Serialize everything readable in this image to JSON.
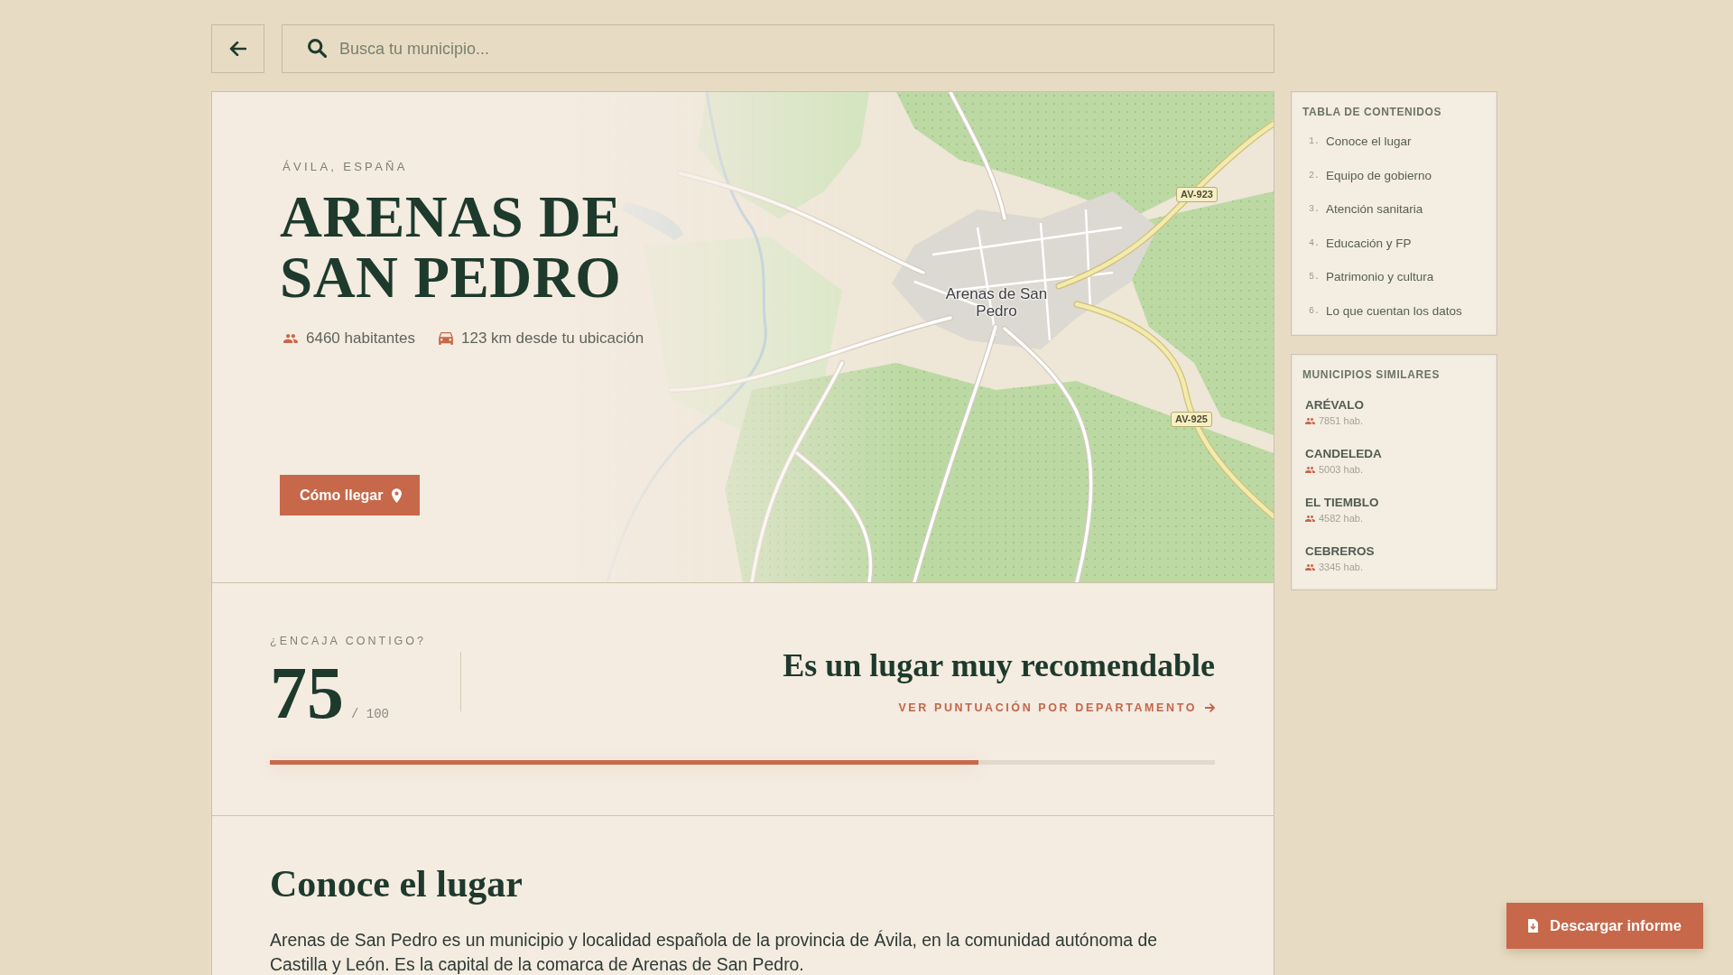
{
  "search": {
    "placeholder": "Busca tu municipio..."
  },
  "hero": {
    "region": "ÁVILA, ESPAÑA",
    "title": "ARENAS DE SAN PEDRO",
    "stats": [
      {
        "kind": "population",
        "text": "6460 habitantes"
      },
      {
        "kind": "distance",
        "text": "123 km desde tu ubicación"
      }
    ],
    "button": "Cómo llegar"
  },
  "map": {
    "labels": [
      {
        "kind": "town",
        "text": "Arenas de San Pedro"
      },
      {
        "kind": "road",
        "text": "AV-923"
      },
      {
        "kind": "road",
        "text": "AV-925"
      }
    ]
  },
  "score": {
    "label": "¿ENCAJA CONTIGO?",
    "value": "75",
    "max": "/ 100",
    "verdict": "Es un lugar muy recomendable",
    "link": "VER PUNTUACIÓN POR DEPARTAMENTO",
    "level": 0.75
  },
  "intro": {
    "heading": "Conoce el lugar",
    "text": "Arenas de San Pedro es un municipio y localidad española de la provincia de Ávila, en la comunidad autónoma de Castilla y León. Es la capital de la comarca de Arenas de San Pedro."
  },
  "toc": {
    "title": "TABLA DE CONTENIDOS",
    "items": [
      {
        "number": "1.",
        "label": "Conoce el lugar"
      },
      {
        "number": "2.",
        "label": "Equipo de gobierno"
      },
      {
        "number": "3.",
        "label": "Atención sanitaria"
      },
      {
        "number": "4.",
        "label": "Educación y FP"
      },
      {
        "number": "5.",
        "label": "Patrimonio y cultura"
      },
      {
        "number": "6.",
        "label": "Lo que cuentan los datos"
      }
    ]
  },
  "similar": {
    "title": "MUNICIPIOS SIMILARES",
    "items": [
      {
        "name": "ARÉVALO",
        "population": "7851 hab."
      },
      {
        "name": "CANDELEDA",
        "population": "5003 hab."
      },
      {
        "name": "EL TIEMBLO",
        "population": "4582 hab."
      },
      {
        "name": "CEBREROS",
        "population": "3345 hab."
      }
    ]
  },
  "download_button": "Descargar informe"
}
